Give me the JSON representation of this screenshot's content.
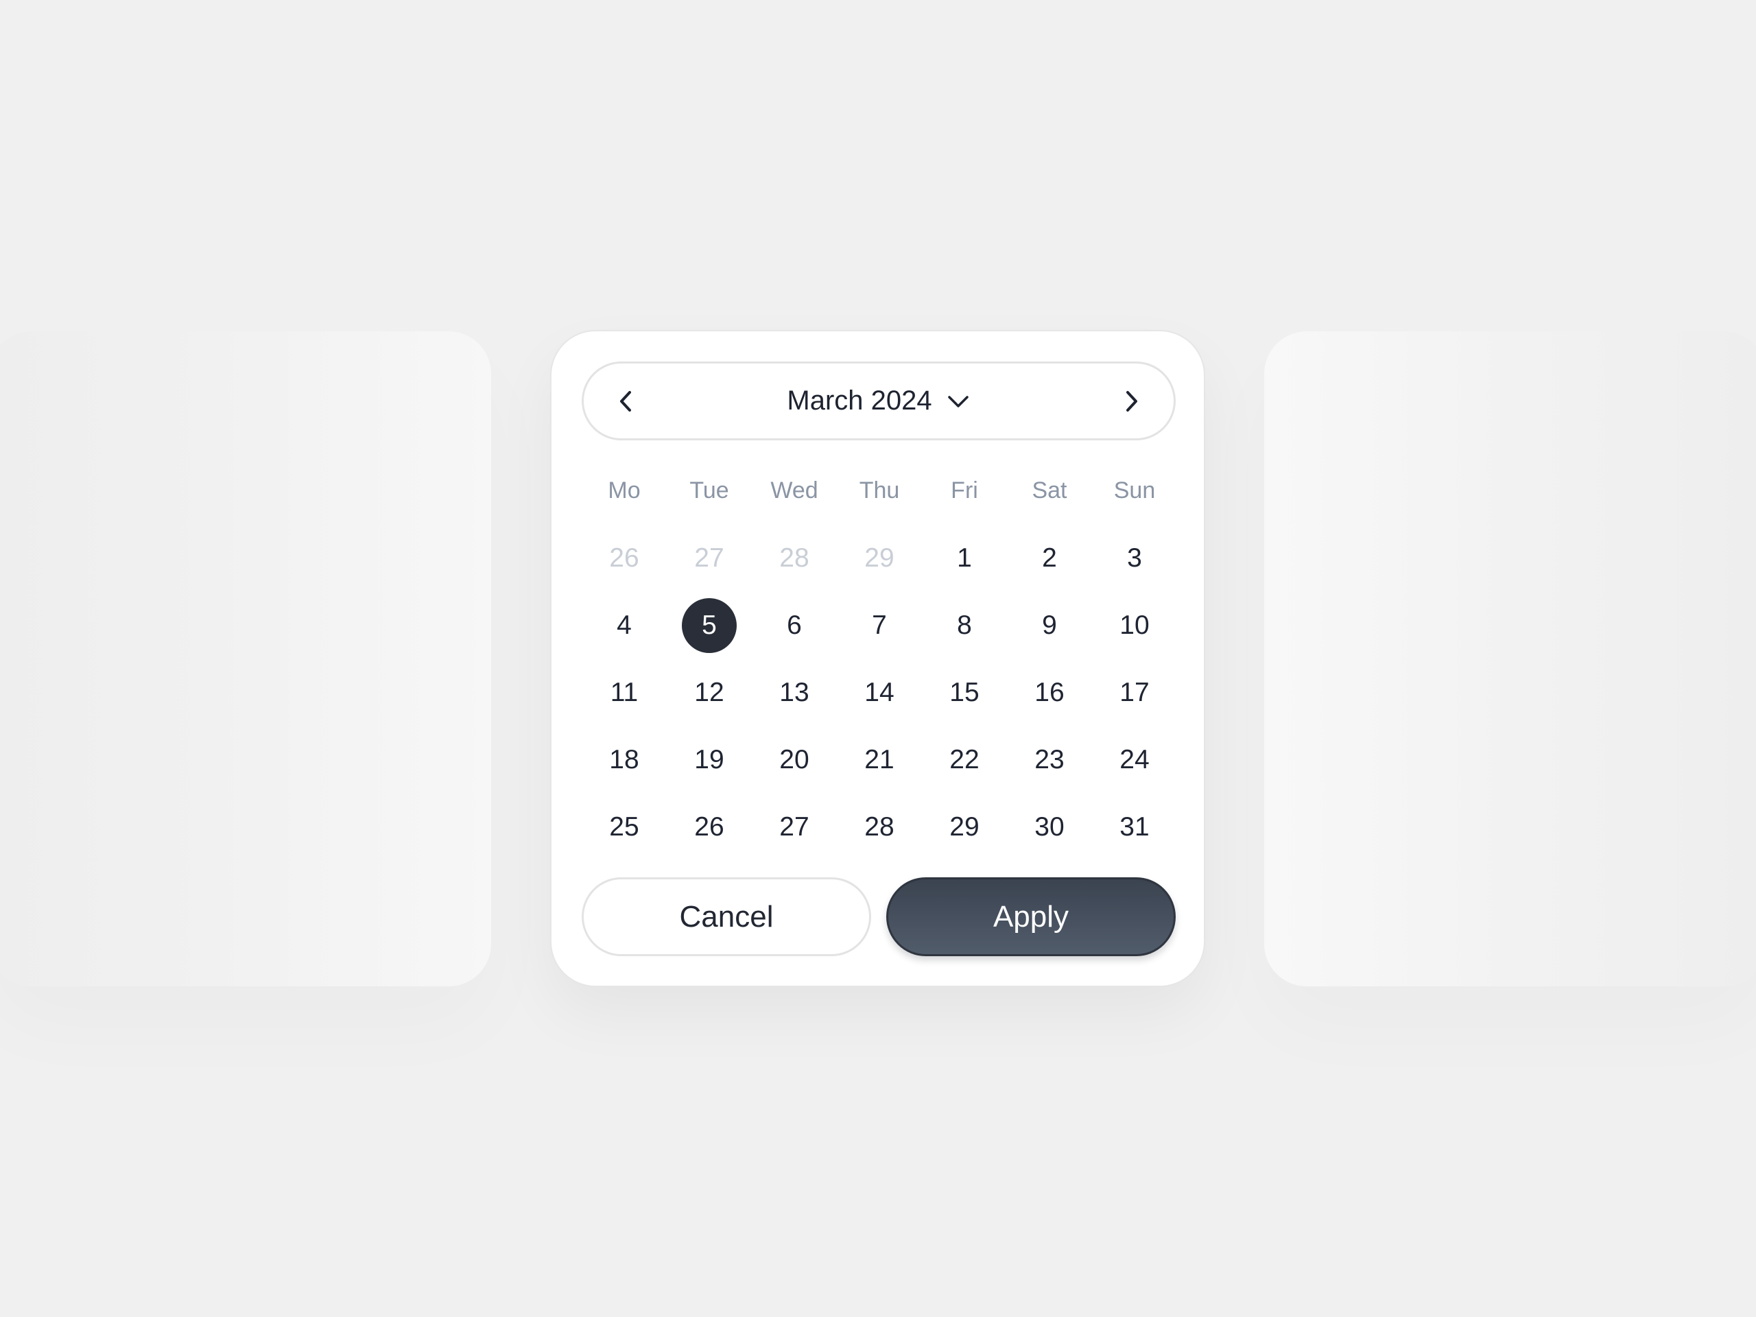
{
  "calendar": {
    "month_label": "March 2024",
    "weekdays": [
      "Mo",
      "Tue",
      "Wed",
      "Thu",
      "Fri",
      "Sat",
      "Sun"
    ],
    "weeks": [
      [
        {
          "label": "26",
          "state": "outside"
        },
        {
          "label": "27",
          "state": "outside"
        },
        {
          "label": "28",
          "state": "outside"
        },
        {
          "label": "29",
          "state": "outside"
        },
        {
          "label": "1",
          "state": "normal"
        },
        {
          "label": "2",
          "state": "normal"
        },
        {
          "label": "3",
          "state": "normal"
        }
      ],
      [
        {
          "label": "4",
          "state": "normal"
        },
        {
          "label": "5",
          "state": "selected"
        },
        {
          "label": "6",
          "state": "normal"
        },
        {
          "label": "7",
          "state": "normal"
        },
        {
          "label": "8",
          "state": "normal"
        },
        {
          "label": "9",
          "state": "normal"
        },
        {
          "label": "10",
          "state": "normal"
        }
      ],
      [
        {
          "label": "11",
          "state": "normal"
        },
        {
          "label": "12",
          "state": "normal"
        },
        {
          "label": "13",
          "state": "normal"
        },
        {
          "label": "14",
          "state": "normal"
        },
        {
          "label": "15",
          "state": "normal"
        },
        {
          "label": "16",
          "state": "normal"
        },
        {
          "label": "17",
          "state": "normal"
        }
      ],
      [
        {
          "label": "18",
          "state": "normal"
        },
        {
          "label": "19",
          "state": "normal"
        },
        {
          "label": "20",
          "state": "normal"
        },
        {
          "label": "21",
          "state": "normal"
        },
        {
          "label": "22",
          "state": "normal"
        },
        {
          "label": "23",
          "state": "normal"
        },
        {
          "label": "24",
          "state": "normal"
        }
      ],
      [
        {
          "label": "25",
          "state": "normal"
        },
        {
          "label": "26",
          "state": "normal"
        },
        {
          "label": "27",
          "state": "normal"
        },
        {
          "label": "28",
          "state": "normal"
        },
        {
          "label": "29",
          "state": "normal"
        },
        {
          "label": "30",
          "state": "normal"
        },
        {
          "label": "31",
          "state": "normal"
        }
      ]
    ]
  },
  "actions": {
    "cancel_label": "Cancel",
    "apply_label": "Apply"
  },
  "icons": {
    "prev": "chevron-left-icon",
    "next": "chevron-right-icon",
    "month_dropdown": "chevron-down-icon"
  },
  "colors": {
    "background": "#f0f0f0",
    "card": "#ffffff",
    "selected_day": "#292e38",
    "apply_button": "#475160",
    "weekday_text": "#8a94a4",
    "outside_day_text": "#c9ced6"
  }
}
